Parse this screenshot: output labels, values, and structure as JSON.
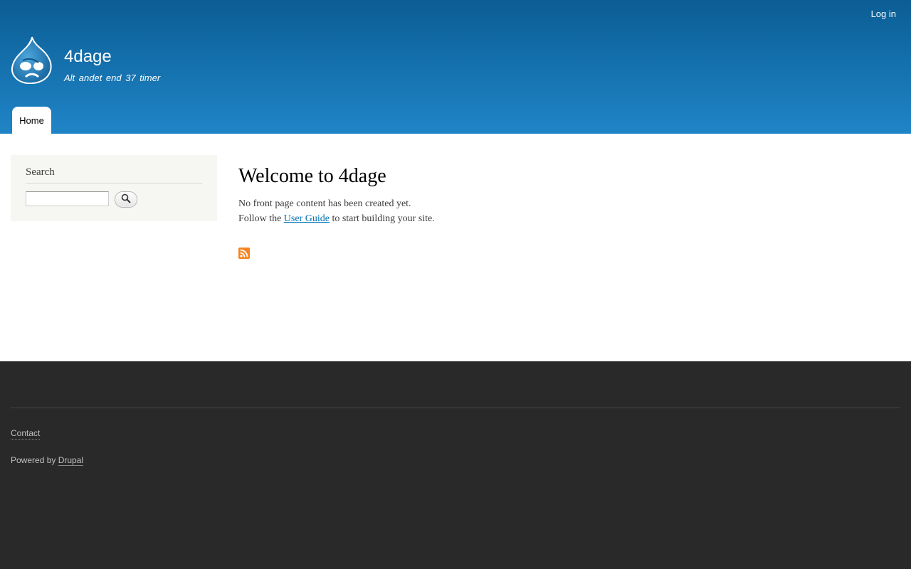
{
  "header": {
    "login_label": "Log in",
    "site_name": "4dage",
    "slogan": "Alt andet end 37 timer",
    "logo_icon": "drupal-drop-icon"
  },
  "nav": {
    "tabs": [
      {
        "label": "Home",
        "active": true
      }
    ]
  },
  "sidebar": {
    "search_block": {
      "title": "Search",
      "input_value": "",
      "button_icon": "magnifier-icon"
    }
  },
  "main": {
    "title": "Welcome to 4dage",
    "message_line1": "No front page content has been created yet.",
    "message_line2_prefix": "Follow the ",
    "message_link": "User Guide",
    "message_line2_suffix": " to start building your site.",
    "feed_icon": "rss-feed-icon"
  },
  "footer": {
    "menu": [
      {
        "label": "Contact"
      }
    ],
    "powered_prefix": "Powered by ",
    "powered_link": "Drupal"
  },
  "colors": {
    "header_top": "#0b5d94",
    "header_bottom": "#1f85c7",
    "footer_bg": "#292929",
    "link": "#0071b3",
    "rss": "#f78422"
  }
}
